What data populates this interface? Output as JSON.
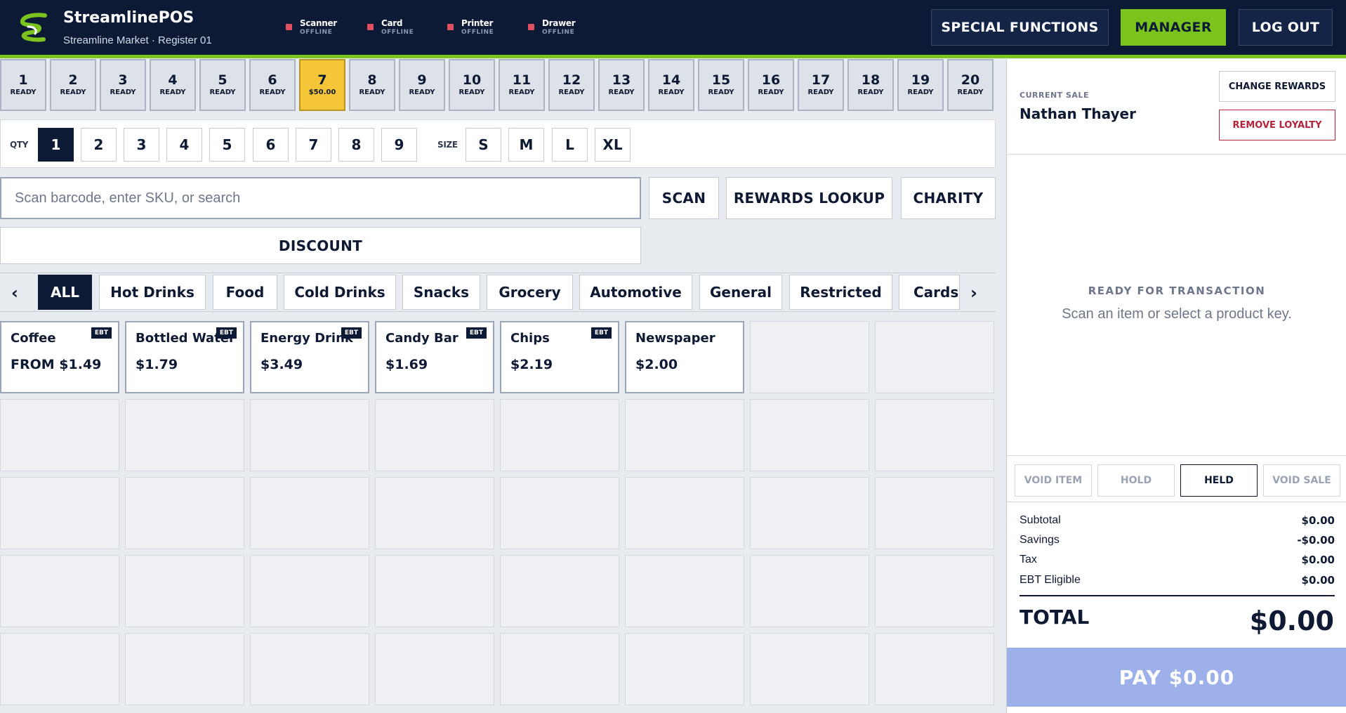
{
  "header": {
    "app_title": "StreamlinePOS",
    "subtitle": "Streamline Market · Register 01",
    "devices": [
      {
        "name": "Scanner",
        "status": "OFFLINE"
      },
      {
        "name": "Card",
        "status": "OFFLINE"
      },
      {
        "name": "Printer",
        "status": "OFFLINE"
      },
      {
        "name": "Drawer",
        "status": "OFFLINE"
      }
    ],
    "special_functions_label": "SPECIAL FUNCTIONS",
    "manager_label": "MANAGER",
    "logout_label": "LOG OUT",
    "accent_color": "#7bc41e",
    "offline_color": "#e0505e"
  },
  "tills": [
    {
      "number": "1",
      "status": "READY"
    },
    {
      "number": "2",
      "status": "READY"
    },
    {
      "number": "3",
      "status": "READY"
    },
    {
      "number": "4",
      "status": "READY"
    },
    {
      "number": "5",
      "status": "READY"
    },
    {
      "number": "6",
      "status": "READY"
    },
    {
      "number": "7",
      "status": "$50.00"
    },
    {
      "number": "8",
      "status": "READY"
    },
    {
      "number": "9",
      "status": "READY"
    },
    {
      "number": "10",
      "status": "READY"
    },
    {
      "number": "11",
      "status": "READY"
    },
    {
      "number": "12",
      "status": "READY"
    },
    {
      "number": "13",
      "status": "READY"
    },
    {
      "number": "14",
      "status": "READY"
    },
    {
      "number": "15",
      "status": "READY"
    },
    {
      "number": "16",
      "status": "READY"
    },
    {
      "number": "17",
      "status": "READY"
    },
    {
      "number": "18",
      "status": "READY"
    },
    {
      "number": "19",
      "status": "READY"
    },
    {
      "number": "20",
      "status": "READY"
    }
  ],
  "active_till": "7",
  "qty": {
    "label": "QTY",
    "options": [
      "1",
      "2",
      "3",
      "4",
      "5",
      "6",
      "7",
      "8",
      "9"
    ],
    "selected": "1"
  },
  "size": {
    "label": "SIZE",
    "options": [
      "S",
      "M",
      "L",
      "XL"
    ]
  },
  "search": {
    "placeholder": "Scan barcode, enter SKU, or search",
    "value": ""
  },
  "actions": {
    "scan": "SCAN",
    "rewards_lookup": "REWARDS LOOKUP",
    "charity": "CHARITY",
    "discount": "DISCOUNT"
  },
  "categories": {
    "prev": "‹",
    "next": "›",
    "items": [
      "ALL",
      "Hot Drinks",
      "Food",
      "Cold Drinks",
      "Snacks",
      "Grocery",
      "Automotive",
      "General",
      "Restricted",
      "Cards"
    ],
    "selected": "ALL"
  },
  "products": [
    {
      "name": "Coffee",
      "price": "FROM $1.49",
      "ebt": "EBT"
    },
    {
      "name": "Bottled Water",
      "price": "$1.79",
      "ebt": "EBT"
    },
    {
      "name": "Energy Drink",
      "price": "$3.49",
      "ebt": "EBT"
    },
    {
      "name": "Candy Bar",
      "price": "$1.69",
      "ebt": "EBT"
    },
    {
      "name": "Chips",
      "price": "$2.19",
      "ebt": "EBT"
    },
    {
      "name": "Newspaper",
      "price": "$2.00",
      "ebt": ""
    }
  ],
  "sale": {
    "current_label": "CURRENT SALE",
    "customer": "Nathan Thayer",
    "change_rewards": "CHANGE REWARDS",
    "remove_loyalty": "REMOVE LOYALTY",
    "ready_title": "READY FOR TRANSACTION",
    "ready_sub": "Scan an item or select a product key.",
    "buttons": {
      "void_item": "VOID ITEM",
      "hold": "HOLD",
      "held": "HELD",
      "void_sale": "VOID SALE"
    },
    "summary": [
      {
        "label": "Subtotal",
        "value": "$0.00"
      },
      {
        "label": "Savings",
        "value": "-$0.00"
      },
      {
        "label": "Tax",
        "value": "$0.00"
      },
      {
        "label": "EBT Eligible",
        "value": "$0.00"
      }
    ],
    "total_label": "TOTAL",
    "total_value": "$0.00",
    "pay_label": "PAY $0.00"
  }
}
